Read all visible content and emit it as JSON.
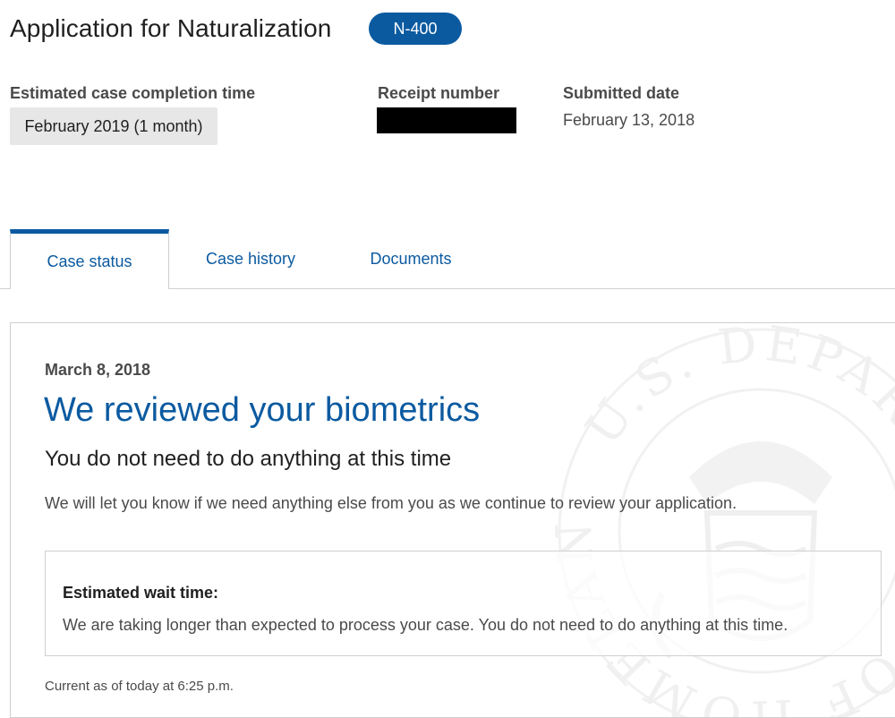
{
  "header": {
    "title": "Application for Naturalization",
    "form_badge": "N-400"
  },
  "case_meta": {
    "completion_label": "Estimated case completion time",
    "completion_value": "February 2019 (1 month)",
    "receipt_label": "Receipt number",
    "submitted_label": "Submitted date",
    "submitted_value": "February 13, 2018"
  },
  "tabs": [
    {
      "label": "Case status",
      "active": true
    },
    {
      "label": "Case history",
      "active": false
    },
    {
      "label": "Documents",
      "active": false
    }
  ],
  "status": {
    "date": "March 8, 2018",
    "title": "We reviewed your biometrics",
    "subtitle": "You do not need to do anything at this time",
    "description": "We will let you know if we need anything else from you as we continue to review your application.",
    "wait_label": "Estimated wait time:",
    "wait_text": "We are taking longer than expected to process your case. You do not need to do anything at this time.",
    "current_as_of": "Current as of today at 6:25 p.m."
  },
  "watermark": {
    "icon": "dhs-seal-icon",
    "text": "U.S. DEPARTMENT OF HOMELAND SECURITY"
  },
  "colors": {
    "accent": "#0b5aa0",
    "redaction": "#000000",
    "value_bg": "#e7e7e7"
  }
}
